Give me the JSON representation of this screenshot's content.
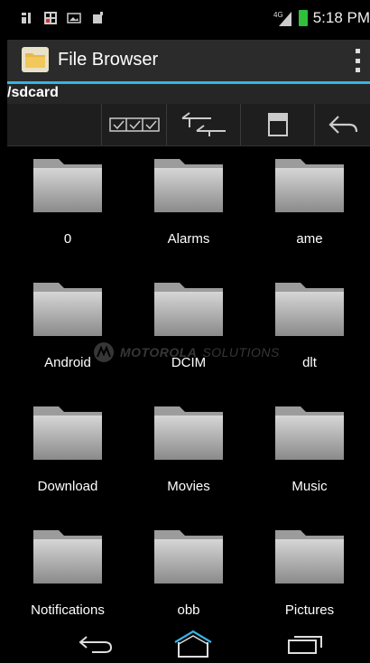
{
  "statusbar": {
    "time": "5:18 PM",
    "network": "4G",
    "icons": [
      "sim-icon",
      "bluetooth-icon",
      "image-notification-icon",
      "download-notification-icon"
    ]
  },
  "actionbar": {
    "title": "File Browser",
    "app_icon": "folder-app-icon",
    "overflow_icon": "overflow-menu-icon"
  },
  "path": "/sdcard",
  "toolbar": {
    "buttons": [
      "select-multiple-icon",
      "swap-icon",
      "save-icon",
      "back-arrow-icon"
    ]
  },
  "folders": [
    {
      "name": "0"
    },
    {
      "name": "Alarms"
    },
    {
      "name": "ame"
    },
    {
      "name": "Android"
    },
    {
      "name": "DCIM"
    },
    {
      "name": "dlt"
    },
    {
      "name": "Download"
    },
    {
      "name": "Movies"
    },
    {
      "name": "Music"
    },
    {
      "name": "Notifications"
    },
    {
      "name": "obb"
    },
    {
      "name": "Pictures"
    }
  ],
  "watermark": {
    "brand": "MOTOROLA",
    "suffix": "SOLUTIONS"
  },
  "navbar": {
    "buttons": [
      "back-icon",
      "home-icon",
      "recent-apps-icon"
    ]
  },
  "colors": {
    "accent": "#33b5e5",
    "actionbar": "#2b2b2b",
    "battery": "#2fbf3a"
  }
}
